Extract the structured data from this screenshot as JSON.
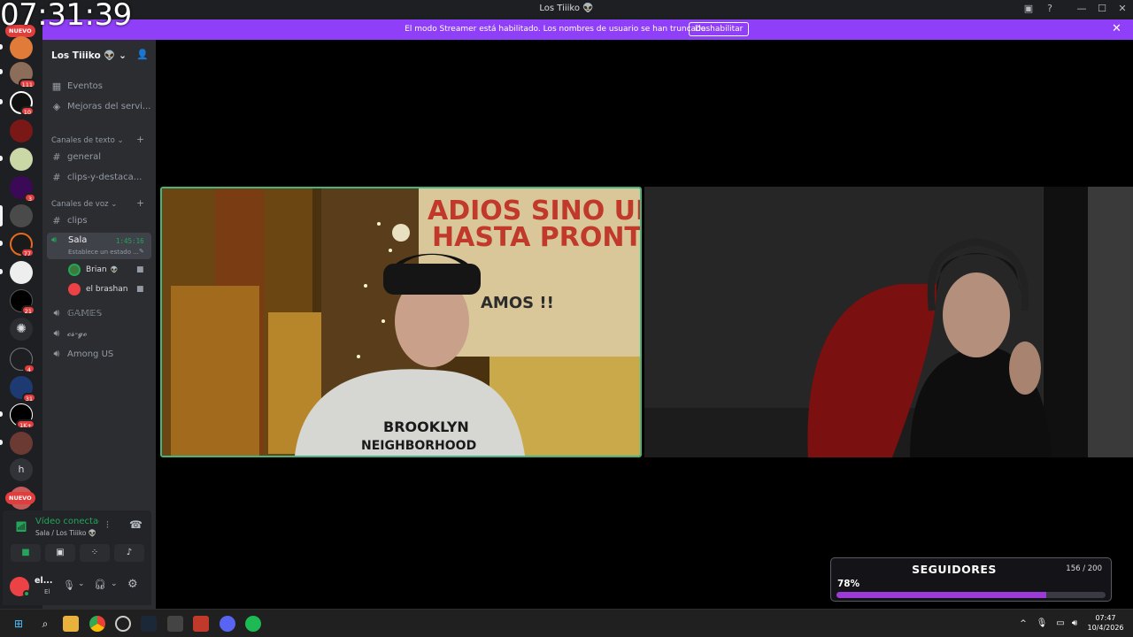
{
  "overlay": {
    "clock": "07:31:39"
  },
  "window": {
    "title": "Los Tiiiko 👽"
  },
  "banner": {
    "text": "El modo Streamer está habilitado. Los nombres de usuario se han truncado.",
    "button": "Deshabilitar"
  },
  "rail": {
    "badges": [
      "111",
      "10",
      "3",
      "77",
      "21",
      "4",
      "31",
      "1K+"
    ],
    "nuevo_top": "NUEVO",
    "nuevo_bottom": "NUEVO",
    "letter_server": "h"
  },
  "sidebar": {
    "server_name": "Los Tiiiko 👽",
    "events": "Eventos",
    "boosts": "Mejoras del servi...",
    "text_category": "Canales de texto",
    "text_channels": [
      "general",
      "clips-y-destaca..."
    ],
    "voice_category": "Canales de voz",
    "clips_channel": "clips",
    "active_voice": {
      "name": "Sala",
      "timer": "1:45:16",
      "status": "Establece un estado ..."
    },
    "voice_users": [
      "Brian",
      "el brashan"
    ],
    "other_voice": [
      "𝔾𝔸𝕄𝔼𝕊",
      "𝓬𝓼-𝓰𝓸",
      "Among US"
    ]
  },
  "voice_panel": {
    "status": "Vídeo conectad",
    "location": "Sala / Los Tiiiko 👽"
  },
  "user_panel": {
    "name": "el...",
    "status": "El"
  },
  "followers": {
    "title": "SEGUIDORES",
    "count": "156 / 200",
    "percent_label": "78%",
    "progress": 0.78
  },
  "taskbar": {
    "time": "07:47",
    "date": "10/4/2026"
  },
  "colors": {
    "brand": "#5865f2",
    "banner": "#8f3ff7",
    "speaking": "#43b581",
    "progress": "#9b3ad6"
  }
}
